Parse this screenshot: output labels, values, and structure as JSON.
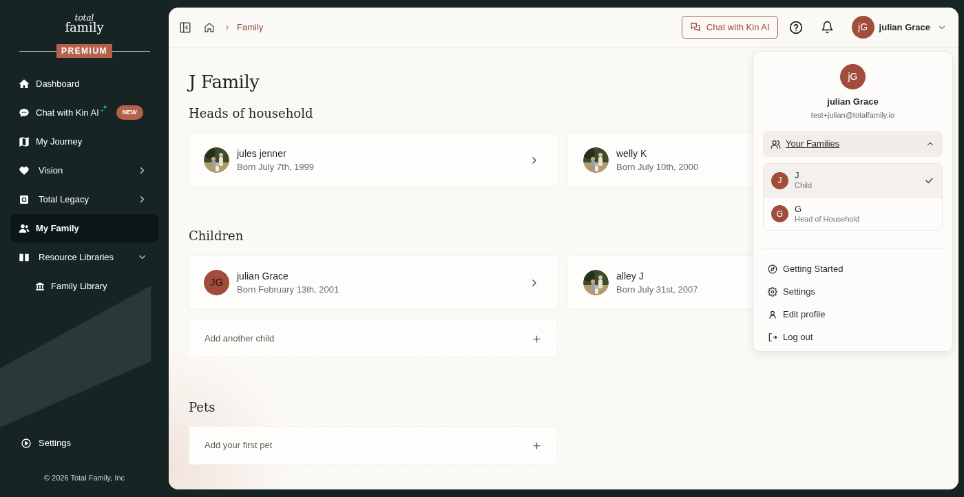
{
  "logo": {
    "line_1": "total",
    "line_2": "family",
    "tier": "PREMIUM"
  },
  "sidebar": {
    "items": [
      {
        "label": "Dashboard",
        "selected": false
      },
      {
        "label": "Chat with Kin AI",
        "selected": false,
        "badge": "NEW"
      },
      {
        "label": "My Journey",
        "selected": false
      },
      {
        "label": "Vision",
        "selected": false,
        "expanded": false
      },
      {
        "label": "Total Legacy",
        "selected": false,
        "expanded": false
      },
      {
        "label": "My Family",
        "selected": true
      },
      {
        "label": "Resource Libraries",
        "selected": false,
        "expanded": true,
        "children": [
          {
            "label": "Family Library",
            "selected": false
          }
        ]
      }
    ],
    "footer": {
      "label": "Settings"
    },
    "copyright": "© 2026 Total Family, Inc"
  },
  "header": {
    "breadcrumb": [
      "Family"
    ],
    "chat_button": "Chat with Kin AI",
    "user": {
      "initials": "jG",
      "name": "julian Grace"
    }
  },
  "page": {
    "title": "J Family",
    "sections": [
      {
        "title": "Heads of household",
        "members": [
          {
            "name": "jules jenner",
            "born": "Born July 7th, 1999"
          },
          {
            "name": "welly K",
            "born": "Born July 10th, 2000"
          }
        ]
      },
      {
        "title": "Children",
        "members": [
          {
            "name": "julian Grace",
            "born": "Born February 13th, 2001",
            "avatar": {
              "kind": "initials",
              "text": "JG"
            }
          },
          {
            "name": "alley J",
            "born": "Born July 31st, 2007"
          }
        ],
        "add": "Add another child"
      },
      {
        "title": "Pets",
        "add": "Add your first pet"
      }
    ]
  },
  "user_menu": {
    "initials": "jG",
    "name": "julian Grace",
    "email": "test+julian@totalfamily.io",
    "families_label": "Your Families",
    "families_expanded": true,
    "families": [
      {
        "initial": "J",
        "name": "J",
        "role": "Child",
        "selected": true
      },
      {
        "initial": "G",
        "name": "G",
        "role": "Head of Household",
        "selected": false
      }
    ],
    "items": [
      {
        "label": "Getting Started"
      },
      {
        "label": "Settings"
      },
      {
        "label": "Edit profile"
      },
      {
        "label": "Log out"
      }
    ]
  }
}
